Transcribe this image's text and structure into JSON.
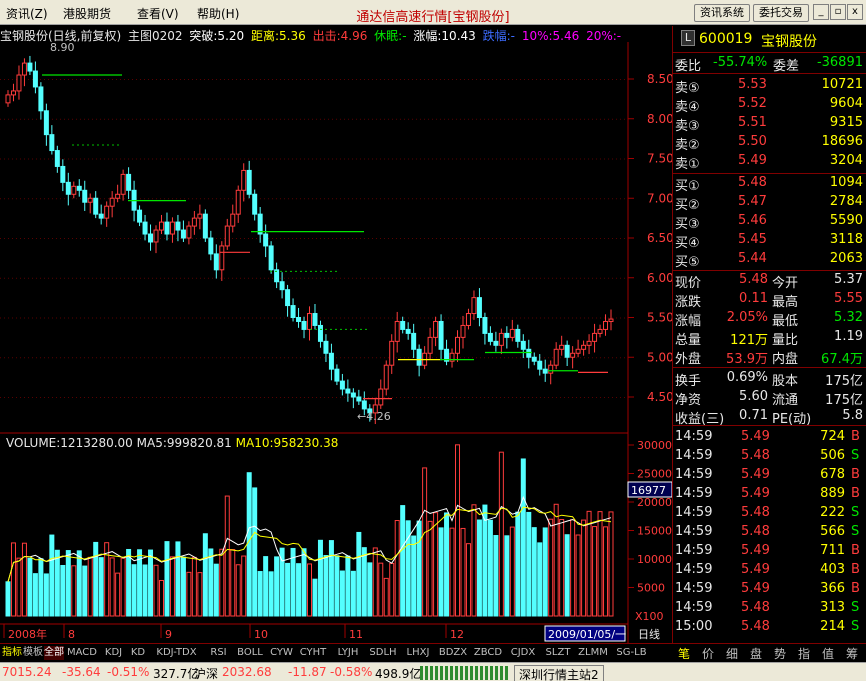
{
  "menu": {
    "items": [
      "资讯(Z)",
      "港股期货",
      "查看(V)",
      "帮助(H)"
    ]
  },
  "app_title": "通达信高速行情[宝钢股份]",
  "toolbar": {
    "news_system": "资讯系统",
    "order_trade": "委托交易"
  },
  "window_controls": {
    "minimize": "_",
    "restore": "▫",
    "close": "x"
  },
  "chart_header": {
    "stock": "宝钢股份(日线,前复权)",
    "main_index": "主图0202",
    "items": [
      {
        "text": "突破:5.20",
        "color": "#ffffff"
      },
      {
        "text": "距离:5.36",
        "color": "#ffff00"
      },
      {
        "text": "出击:4.96",
        "color": "#ff3c3c"
      },
      {
        "text": "休眠:-",
        "color": "#00e600"
      },
      {
        "text": "涨幅:10.43",
        "color": "#ffffff"
      },
      {
        "text": "跌幅:-",
        "color": "#3c6cff"
      },
      {
        "text": "10%:5.46",
        "color": "#ff00ff"
      },
      {
        "text": "20%:-",
        "color": "#ff00ff"
      }
    ]
  },
  "price_axis": {
    "labels": [
      "8.50",
      "8.00",
      "7.50",
      "7.00",
      "6.50",
      "6.00",
      "5.50",
      "5.00",
      "4.50"
    ]
  },
  "annotations": {
    "high": "8.90",
    "low": "←4.26"
  },
  "volume_header": {
    "vol": "VOLUME:1213280.00",
    "ma5": "MA5:999820.81",
    "ma10": "MA10:958230.38"
  },
  "volume_axis": {
    "labels": [
      "30000",
      "25000",
      "20000",
      "15000",
      "10000",
      "5000"
    ],
    "multiplier": "X100",
    "marker": "16977"
  },
  "date_axis": {
    "labels": [
      "2008年",
      "8",
      "9",
      "10",
      "11",
      "12"
    ],
    "current_date": "2009/01/05/一",
    "period": "日线"
  },
  "bottom_tabs": [
    "指标",
    "模板",
    "全部",
    "MACD",
    "KDJ",
    "KD",
    "KDJ-TDX",
    "RSI",
    "BOLL",
    "CYW",
    "CYHT",
    "LYJH",
    "SDLH",
    "LHXJ",
    "BDZX",
    "ZBCD",
    "CJDX",
    "SLZT",
    "ZLMM",
    "SG-LB"
  ],
  "quote": {
    "code": "600019",
    "name": "宝钢股份",
    "webi_label": "委比",
    "webi_value": "-55.74%",
    "weicha_label": "委差",
    "weicha_value": "-36891",
    "asks": [
      {
        "label": "卖⑤",
        "price": "5.53",
        "vol": "10721"
      },
      {
        "label": "卖④",
        "price": "5.52",
        "vol": "9604"
      },
      {
        "label": "卖③",
        "price": "5.51",
        "vol": "9315"
      },
      {
        "label": "卖②",
        "price": "5.50",
        "vol": "18696"
      },
      {
        "label": "卖①",
        "price": "5.49",
        "vol": "3204"
      }
    ],
    "bids": [
      {
        "label": "买①",
        "price": "5.48",
        "vol": "1094"
      },
      {
        "label": "买②",
        "price": "5.47",
        "vol": "2784"
      },
      {
        "label": "买③",
        "price": "5.46",
        "vol": "5590"
      },
      {
        "label": "买④",
        "price": "5.45",
        "vol": "3118"
      },
      {
        "label": "买⑤",
        "price": "5.44",
        "vol": "2063"
      }
    ],
    "stats": [
      {
        "l1": "现价",
        "v1": "5.48",
        "c1": "#ff3c3c",
        "l2": "今开",
        "v2": "5.37",
        "c2": "#e8e8e8"
      },
      {
        "l1": "涨跌",
        "v1": "0.11",
        "c1": "#ff3c3c",
        "l2": "最高",
        "v2": "5.55",
        "c2": "#ff3c3c"
      },
      {
        "l1": "涨幅",
        "v1": "2.05%",
        "c1": "#ff3c3c",
        "l2": "最低",
        "v2": "5.32",
        "c2": "#00e600"
      },
      {
        "l1": "总量",
        "v1": "121万",
        "c1": "#ffff00",
        "l2": "量比",
        "v2": "1.19",
        "c2": "#e8e8e8"
      },
      {
        "l1": "外盘",
        "v1": "53.9万",
        "c1": "#ff3c3c",
        "l2": "内盘",
        "v2": "67.4万",
        "c2": "#00e600"
      }
    ],
    "fundamentals": [
      {
        "l1": "换手",
        "v1": "0.69%",
        "l2": "股本",
        "v2": "175亿"
      },
      {
        "l1": "净资",
        "v1": "5.60",
        "l2": "流通",
        "v2": "175亿"
      },
      {
        "l1": "收益(三)",
        "v1": "0.71",
        "l2": "PE(动)",
        "v2": "5.8"
      }
    ],
    "ticks": [
      {
        "time": "14:59",
        "price": "5.49",
        "vol": "724",
        "side": "B"
      },
      {
        "time": "14:59",
        "price": "5.48",
        "vol": "506",
        "side": "S"
      },
      {
        "time": "14:59",
        "price": "5.49",
        "vol": "678",
        "side": "B"
      },
      {
        "time": "14:59",
        "price": "5.49",
        "vol": "889",
        "side": "B"
      },
      {
        "time": "14:59",
        "price": "5.48",
        "vol": "222",
        "side": "S"
      },
      {
        "time": "14:59",
        "price": "5.48",
        "vol": "566",
        "side": "S"
      },
      {
        "time": "14:59",
        "price": "5.49",
        "vol": "711",
        "side": "B"
      },
      {
        "time": "14:59",
        "price": "5.49",
        "vol": "403",
        "side": "B"
      },
      {
        "time": "14:59",
        "price": "5.49",
        "vol": "366",
        "side": "B"
      },
      {
        "time": "14:59",
        "price": "5.48",
        "vol": "313",
        "side": "S"
      },
      {
        "time": "15:00",
        "price": "5.48",
        "vol": "214",
        "side": "S"
      }
    ]
  },
  "right_tabs": [
    "笔",
    "价",
    "细",
    "盘",
    "势",
    "指",
    "值",
    "筹"
  ],
  "status_bar": {
    "sh_index": "7015.24",
    "sh_change": "-35.64",
    "sh_pct": "-0.51%",
    "sh_amount": "327.7亿",
    "sz_label": "沪深",
    "sz_index": "2032.68",
    "sz_change": "-11.87",
    "sz_pct": "-0.58%",
    "sz_amount": "498.9亿",
    "server": "深圳行情主站2"
  }
}
